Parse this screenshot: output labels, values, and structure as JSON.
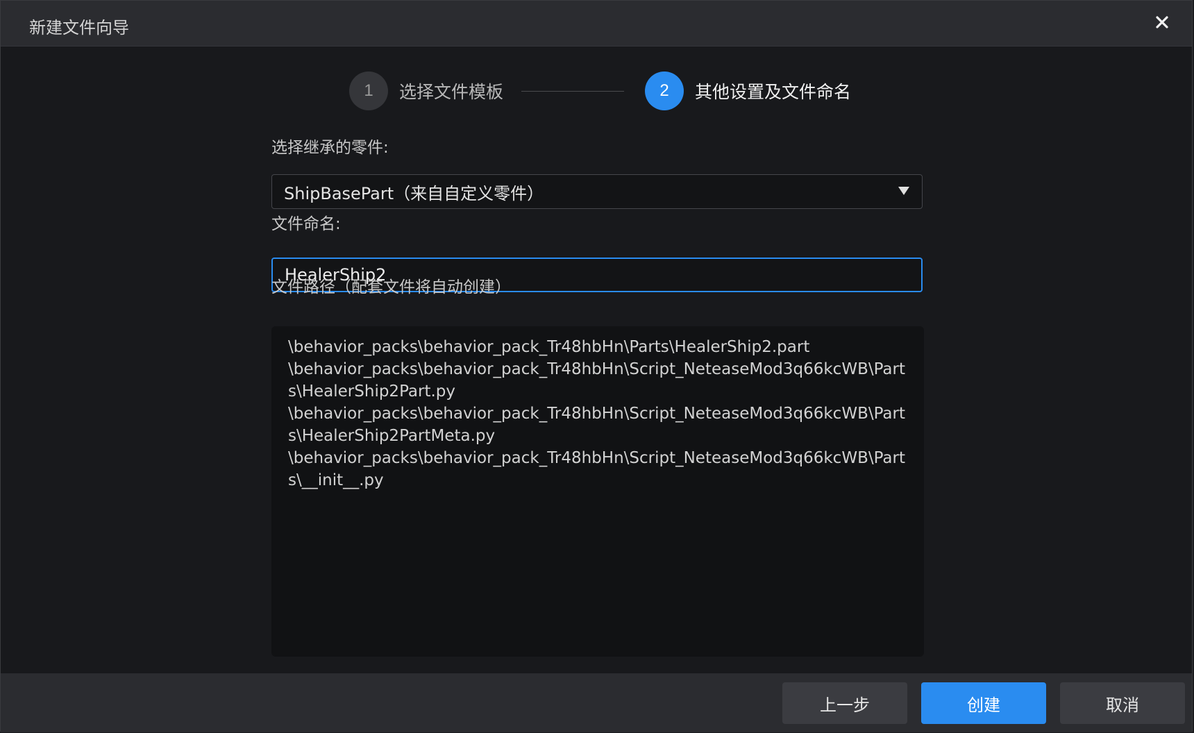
{
  "window": {
    "title": "新建文件向导",
    "close_icon": "close-icon"
  },
  "stepper": {
    "steps": [
      {
        "number": "1",
        "label": "选择文件模板",
        "state": "completed"
      },
      {
        "number": "2",
        "label": "其他设置及文件命名",
        "state": "active"
      }
    ]
  },
  "form": {
    "parent_label": "选择继承的零件:",
    "parent_value": "ShipBasePart（来自自定义零件）",
    "name_label": "文件命名:",
    "name_value": "HealerShip2",
    "path_label": "文件路径（配套文件将自动创建）",
    "paths": [
      "\\behavior_packs\\behavior_pack_Tr48hbHn\\Parts\\HealerShip2.part",
      "\\behavior_packs\\behavior_pack_Tr48hbHn\\Script_NeteaseMod3q66kcWB\\Parts\\HealerShip2Part.py",
      "\\behavior_packs\\behavior_pack_Tr48hbHn\\Script_NeteaseMod3q66kcWB\\Parts\\HealerShip2PartMeta.py",
      "\\behavior_packs\\behavior_pack_Tr48hbHn\\Script_NeteaseMod3q66kcWB\\Parts\\__init__.py"
    ]
  },
  "footer": {
    "prev_label": "上一步",
    "create_label": "创建",
    "cancel_label": "取消"
  },
  "colors": {
    "accent": "#2a8cf0",
    "background": "#18191c",
    "panel": "#2b2c30"
  }
}
